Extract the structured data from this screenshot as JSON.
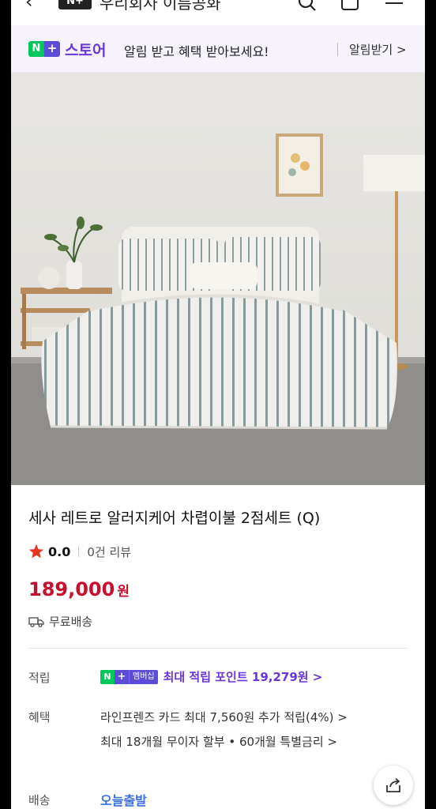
{
  "header": {
    "back_icon": "chevron-left-icon",
    "logo_text": "N+",
    "store_name": "우리회사 이름공화",
    "search_icon": "search-icon",
    "cart_icon": "shopping-bag-icon",
    "menu_icon": "hamburger-menu-icon"
  },
  "banner": {
    "badge_n": "N",
    "badge_plus": "+",
    "store_word": "스토어",
    "message": "알림 받고 혜택 받아보세요!",
    "link": "알림받기 >"
  },
  "product": {
    "title": "세사 레트로 알러지케어 차렵이불 2점세트 (Q)",
    "rating": "0.0",
    "reviews": "0건 리뷰",
    "price": "189,000",
    "price_unit": "원",
    "shipping": "무료배송"
  },
  "details": {
    "points_label": "적립",
    "badge_n": "N",
    "badge_plus": "+",
    "badge_member": "멤버십",
    "points_text": "최대 적립 포인트 19,279원 >",
    "benefit_label": "혜택",
    "benefit_line1": "라인프렌즈 카드 최대 7,560원 추가 적립(4%) >",
    "benefit_line2": "최대 18개월 무이자 할부 • 60개월 특별금리 >",
    "delivery_label": "배송",
    "delivery_value": "오늘출발"
  },
  "colors": {
    "naver_green": "#03c75a",
    "naver_purple": "#5c4dd8",
    "price_red": "#c8102e",
    "delivery_blue": "#3a6fe0"
  }
}
